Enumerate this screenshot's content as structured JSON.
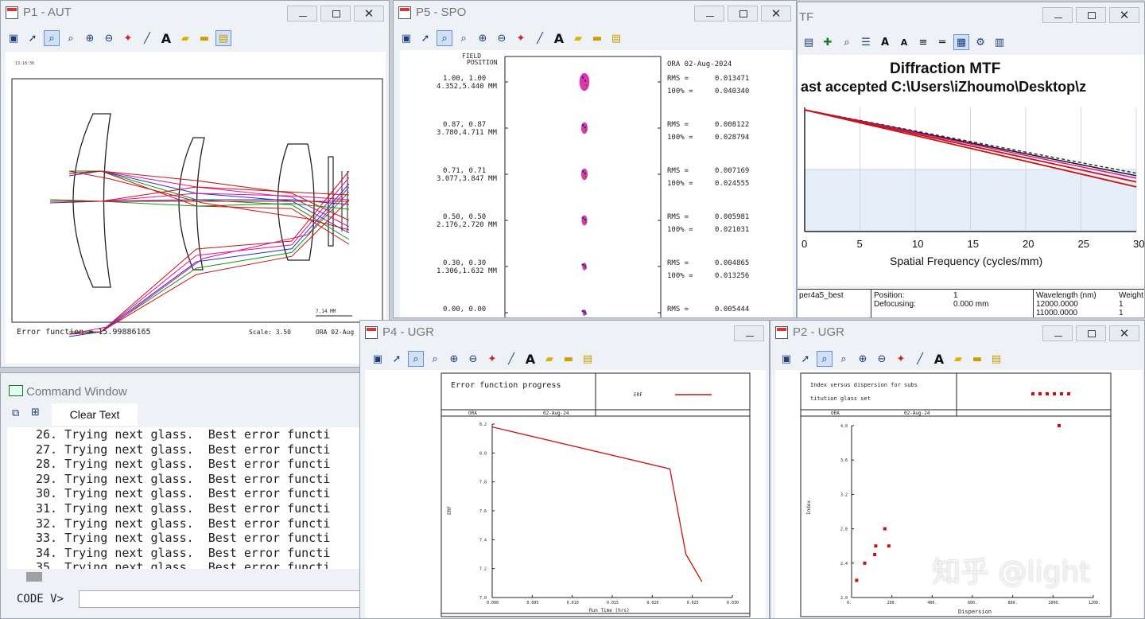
{
  "p1": {
    "title": "P1 - AUT",
    "time": "13:18:36",
    "scale_label": "7.14   MM",
    "status_error": "Error function = 15.99886165",
    "status_scale": "Scale:    3.50",
    "status_ora": "ORA   02-Aug"
  },
  "p5": {
    "title": "P5 - SPO",
    "field_header_1": "FIELD",
    "field_header_2": "POSITION",
    "ora_date": "ORA  02-Aug-2024",
    "rows": [
      {
        "field": "1.00, 1.00",
        "pos": "4.352,5.440  MM",
        "rms_label": "RMS   =",
        "rms": "0.013471",
        "p100_label": "100% =",
        "p100": "0.040340"
      },
      {
        "field": "0.87, 0.87",
        "pos": "3.780,4.711  MM",
        "rms_label": "RMS   =",
        "rms": "0.008122",
        "p100_label": "100% =",
        "p100": "0.028794"
      },
      {
        "field": "0.71, 0.71",
        "pos": "3.077,3.847  MM",
        "rms_label": "RMS   =",
        "rms": "0.007169",
        "p100_label": "100% =",
        "p100": "0.024555"
      },
      {
        "field": "0.50, 0.50",
        "pos": "2.176,2.720  MM",
        "rms_label": "RMS   =",
        "rms": "0.005981",
        "p100_label": "100% =",
        "p100": "0.021031"
      },
      {
        "field": "0.30, 0.30",
        "pos": "1.306,1.632  MM",
        "rms_label": "RMS   =",
        "rms": "0.004865",
        "p100_label": "100% =",
        "p100": "0.013256"
      },
      {
        "field": "0.00, 0.00",
        "pos": "",
        "rms_label": "RMS   =",
        "rms": "0.005444",
        "p100_label": "",
        "p100": ""
      }
    ]
  },
  "mtf": {
    "title": "TF",
    "chart_title": "Diffraction MTF",
    "chart_subtitle": "ast accepted C:\\Users\\iZhoumo\\Desktop\\z",
    "xlabel": "Spatial Frequency (cycles/mm)",
    "xticks": [
      "0",
      "5",
      "10",
      "15",
      "20",
      "25",
      "30"
    ],
    "info_name": "per4a5_best",
    "position_label": "Position:",
    "position_value": "1",
    "defocus_label": "Defocusing:",
    "defocus_value": "0.000 mm",
    "wavelength_header": "Wavelength (nm)",
    "weight_header": "Weight",
    "wavelengths": [
      {
        "nm": "12000.0000",
        "w": "1"
      },
      {
        "nm": "11000.0000",
        "w": "1"
      }
    ]
  },
  "cmd": {
    "title": "Command Window",
    "clear_text": "Clear Text",
    "prompt": "CODE V>",
    "lines": [
      "26. Trying next glass.  Best error functi",
      "27. Trying next glass.  Best error functi",
      "28. Trying next glass.  Best error functi",
      "29. Trying next glass.  Best error functi",
      "30. Trying next glass.  Best error functi",
      "31. Trying next glass.  Best error functi",
      "32. Trying next glass.  Best error functi",
      "33. Trying next glass.  Best error functi",
      "34. Trying next glass.  Best error functi",
      "35. Trying next glass.  Best error functi"
    ]
  },
  "p4": {
    "title": "P4 - UGR",
    "box_title": "Error function progress",
    "legend_label": "ERF",
    "ora": "ORA",
    "date": "02-Aug-24",
    "ylabel": "ERF",
    "xlabel": "Run Time (hrs)"
  },
  "p2": {
    "title": "P2 - UGR",
    "box_title_1": "Index versus dispersion for subs",
    "box_title_2": "titution glass set",
    "ora": "ORA",
    "date": "02-Aug-24",
    "ylabel": "Index",
    "xlabel": "Dispersion"
  },
  "watermark": "知乎 @light",
  "chart_data": [
    {
      "type": "line",
      "name": "erf-progress",
      "title": "Error function progress",
      "xlabel": "Run Time (hrs)",
      "ylabel": "ERF",
      "xlim": [
        0.0,
        0.03
      ],
      "ylim": [
        7.0,
        8.2
      ],
      "xticks": [
        "0.000",
        "0.005",
        "0.010",
        "0.015",
        "0.020",
        "0.025",
        "0.030"
      ],
      "yticks": [
        "7.0",
        "7.2",
        "7.4",
        "7.6",
        "7.8",
        "8.0",
        "8.2"
      ],
      "series": [
        {
          "name": "ERF",
          "x": [
            0.0,
            0.0222,
            0.0242,
            0.0262
          ],
          "y": [
            8.18,
            7.89,
            7.3,
            7.11
          ]
        }
      ]
    },
    {
      "type": "scatter",
      "name": "index-vs-dispersion",
      "title": "Index versus dispersion for substitution glass set",
      "xlabel": "Dispersion",
      "ylabel": "Index",
      "xlim": [
        0,
        1200
      ],
      "ylim": [
        2.0,
        4.0
      ],
      "xticks": [
        "0.",
        "200.",
        "400.",
        "600.",
        "800.",
        "1000.",
        "1200."
      ],
      "yticks": [
        "2.0",
        "2.4",
        "2.8",
        "3.2",
        "3.6",
        "4.0"
      ],
      "series": [
        {
          "name": "glasses",
          "x": [
            25,
            65,
            115,
            120,
            165,
            185,
            1030
          ],
          "y": [
            2.2,
            2.4,
            2.5,
            2.6,
            2.8,
            2.6,
            4.0
          ]
        }
      ]
    },
    {
      "type": "line",
      "name": "diffraction-mtf",
      "title": "Diffraction MTF",
      "xlabel": "Spatial Frequency (cycles/mm)",
      "xlim": [
        0,
        30
      ],
      "xticks": [
        "0",
        "5",
        "10",
        "15",
        "20",
        "25",
        "30"
      ],
      "series": [
        {
          "name": "black-a",
          "x": [
            0,
            30
          ],
          "y": [
            0.98,
            0.45
          ]
        },
        {
          "name": "dashed-black",
          "x": [
            0,
            30
          ],
          "y": [
            0.98,
            0.47
          ]
        },
        {
          "name": "magenta",
          "x": [
            0,
            30
          ],
          "y": [
            0.98,
            0.43
          ]
        },
        {
          "name": "red-a",
          "x": [
            0,
            30
          ],
          "y": [
            0.98,
            0.4
          ]
        },
        {
          "name": "red-b",
          "x": [
            0,
            30
          ],
          "y": [
            0.98,
            0.36
          ]
        }
      ]
    }
  ],
  "colors": {
    "ray_red": "#cc1111",
    "ray_magenta": "#e0119a",
    "ray_blue": "#2233cc",
    "ray_green": "#119911",
    "accent": "#cc1111"
  }
}
